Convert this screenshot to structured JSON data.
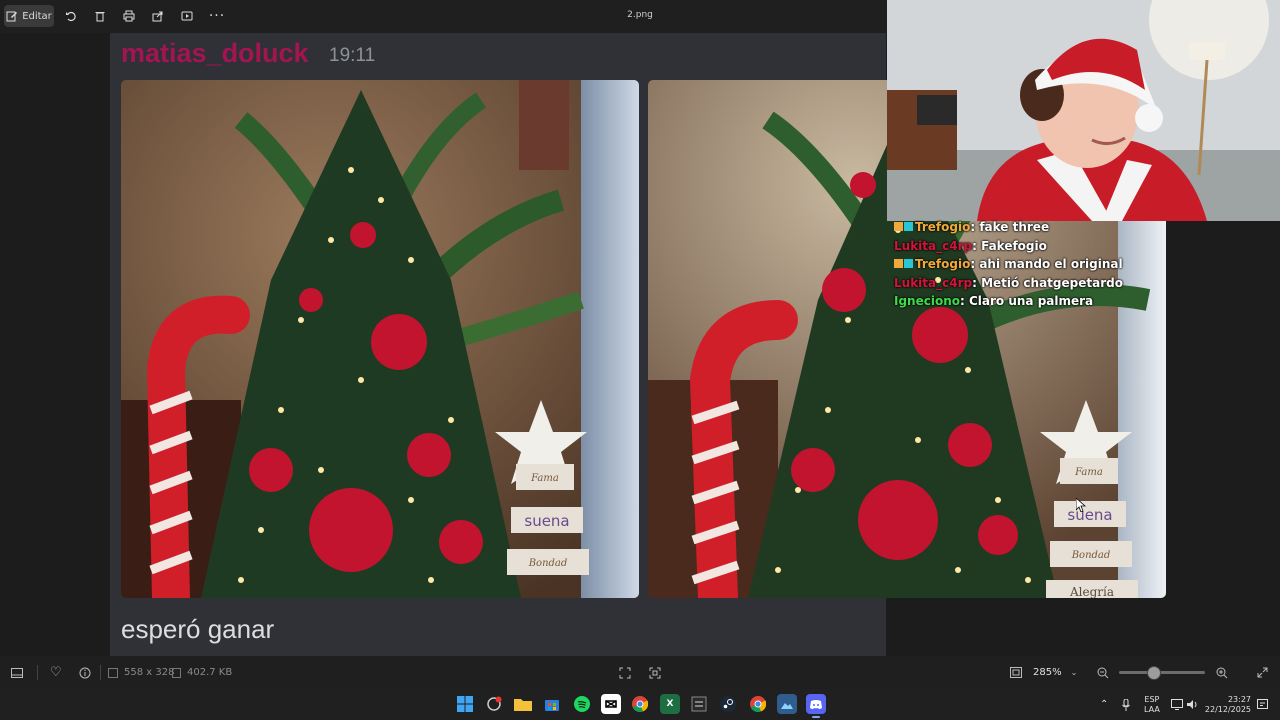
{
  "toolbar": {
    "edit_label": "Editar",
    "file_name": "2.png"
  },
  "message": {
    "username": "matias_doluck",
    "time": "19:11",
    "caption": "esperó ganar"
  },
  "chat": [
    {
      "user": "Trefogio",
      "text": ": fake three",
      "color": "#f2a93b",
      "badge": true
    },
    {
      "user": "Lukita_c4rp",
      "text": ": Fakefogio",
      "color": "#d4143c",
      "badge": false
    },
    {
      "user": "Trefogio",
      "text": ": ahi mando el original",
      "color": "#f2a93b",
      "badge": true
    },
    {
      "user": "Lukita_c4rp",
      "text": ": Metió chatgepetardo",
      "color": "#d4143c",
      "badge": false
    },
    {
      "user": "Igneciono",
      "text": ": Claro una palmera",
      "color": "#3fd94a",
      "badge": false
    }
  ],
  "photo_signs": {
    "sign1": "Fama",
    "sign2": "suena",
    "sign3": "Bondad",
    "sign4": "Alegría"
  },
  "statusbar": {
    "dimensions": "558 x 328",
    "file_size": "402.7 KB",
    "zoom": "285%",
    "zoom_level": 0.4
  },
  "tray": {
    "lang": "ESP",
    "layout": "LAA",
    "time": "23:27",
    "date": "22/12/2025"
  },
  "icons": [
    "edit-icon",
    "rotate-icon",
    "delete-icon",
    "print-icon",
    "share-icon",
    "slideshow-icon",
    "more-icon",
    "film-strip-icon",
    "favorite-icon",
    "info-icon",
    "dimensions-icon",
    "file-size-icon",
    "fit-icon",
    "crop-icon",
    "actual-size-icon",
    "zoom-out-icon",
    "zoom-in-icon",
    "fullscreen-icon"
  ]
}
